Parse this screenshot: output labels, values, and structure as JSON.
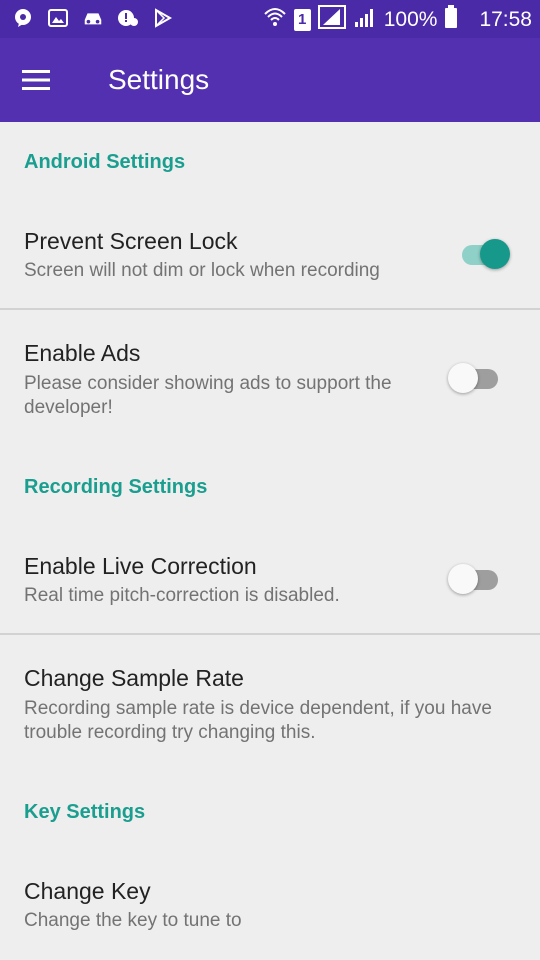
{
  "status_bar": {
    "battery": "100%",
    "time": "17:58",
    "sim_slot": "1",
    "icons": [
      "chat-bubble-icon",
      "image-icon",
      "car-icon",
      "alert-cloud-icon",
      "play-store-icon",
      "wifi-icon",
      "signal-icon"
    ]
  },
  "app_bar": {
    "title": "Settings",
    "menu_icon": "hamburger-menu-icon"
  },
  "sections": {
    "android": {
      "header": "Android Settings",
      "prevent_screen_lock": {
        "title": "Prevent Screen Lock",
        "summary": "Screen will not dim or lock when recording",
        "enabled": true
      },
      "enable_ads": {
        "title": "Enable Ads",
        "summary": "Please consider showing ads to support the developer!",
        "enabled": false
      }
    },
    "recording": {
      "header": "Recording Settings",
      "live_correction": {
        "title": "Enable Live Correction",
        "summary": "Real time pitch-correction is disabled.",
        "enabled": false
      },
      "sample_rate": {
        "title": "Change Sample Rate",
        "summary": "Recording sample rate is device dependent, if you have trouble recording try changing this."
      }
    },
    "key": {
      "header": "Key Settings",
      "change_key": {
        "title": "Change Key",
        "summary": "Change the key to tune to"
      }
    }
  },
  "colors": {
    "status_bar": "#4a2aa6",
    "app_bar": "#5330b0",
    "accent": "#1a9e8f",
    "background": "#eeeeee"
  }
}
